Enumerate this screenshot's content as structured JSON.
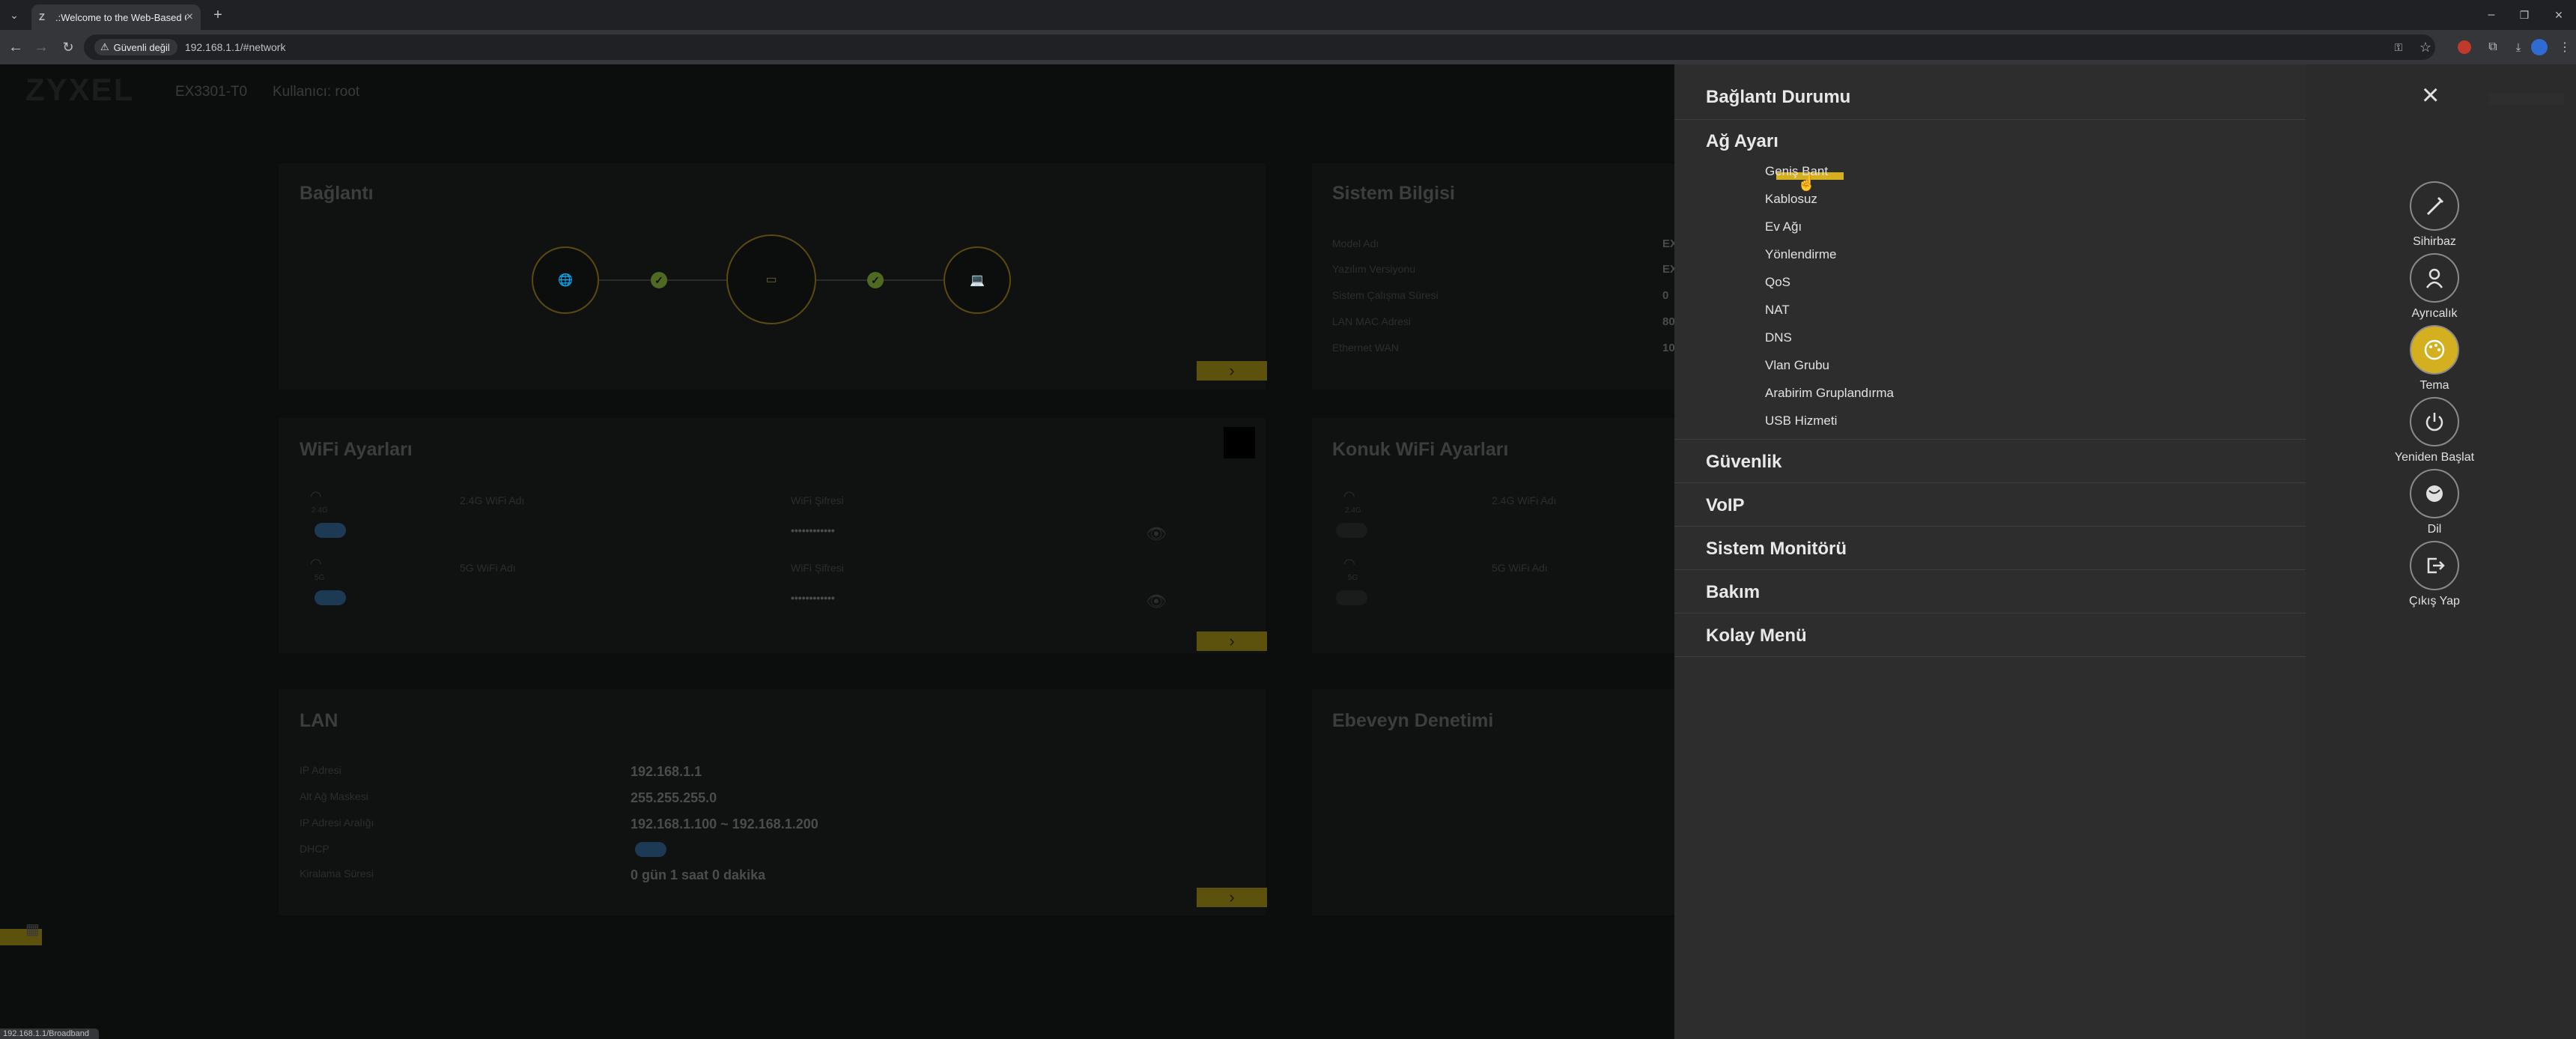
{
  "browser": {
    "tab_title": ".:Welcome to the Web-Based C",
    "security_chip": "Güvenli değil",
    "url": "192.168.1.1/#network",
    "status_url": "192.168.1.1/Broadband"
  },
  "header": {
    "logo": "ZYXEL",
    "model": "EX3301-T0",
    "user": "Kullanıcı: root"
  },
  "cards": {
    "baglanti": {
      "title": "Bağlantı"
    },
    "sistem": {
      "title": "Sistem Bilgisi",
      "labels": [
        "Model Adı",
        "Yazılım Versiyonu",
        "Sistem Çalışma Süresi",
        "LAN MAC Adresi",
        "Ethernet WAN"
      ],
      "values": [
        "EX",
        "EX",
        "0",
        "80",
        "10"
      ]
    },
    "wifi": {
      "title": "WiFi Ayarları",
      "band24": "2.4G",
      "band5": "5G",
      "name24_label": "2.4G WiFi Adı",
      "name5_label": "5G WiFi Adı",
      "pass_label": "WiFi Şifresi",
      "pass_value": "••••••••••••"
    },
    "guest": {
      "title": "Konuk WiFi Ayarları",
      "band24": "2.4G",
      "band5": "5G",
      "name24_label": "2.4G WiFi Adı",
      "name5_label": "5G WiFi Adı"
    },
    "lan": {
      "title": "LAN",
      "labels": [
        "IP Adresi",
        "Alt Ağ Maskesi",
        "IP Adresi Aralığı",
        "DHCP",
        "Kiralama Süresi"
      ],
      "values": [
        "192.168.1.1",
        "255.255.255.0",
        "192.168.1.100 ~ 192.168.1.200",
        "",
        "0 gün 1 saat 0 dakika"
      ]
    },
    "parent": {
      "title": "Ebeveyn Denetimi"
    }
  },
  "menu": {
    "baglanti_durumu": "Bağlantı Durumu",
    "ag_ayari": "Ağ Ayarı",
    "ag_items": [
      "Geniş Bant",
      "Kablosuz",
      "Ev Ağı",
      "Yönlendirme",
      "QoS",
      "NAT",
      "DNS",
      "Vlan Grubu",
      "Arabirim Gruplandırma",
      "USB Hizmeti"
    ],
    "guvenlik": "Güvenlik",
    "voip": "VoIP",
    "sistem_monitoru": "Sistem Monitörü",
    "bakim": "Bakım",
    "kolay_menu": "Kolay Menü"
  },
  "rail": {
    "wizard": "Sihirbaz",
    "preferences": "Ayrıcalık",
    "theme": "Tema",
    "restart": "Yeniden Başlat",
    "language": "Dil",
    "logout": "Çıkış Yap"
  },
  "colors": {
    "accent": "#d4b020",
    "drawer": "#2d2d2d",
    "rail": "#2b2b2b"
  }
}
